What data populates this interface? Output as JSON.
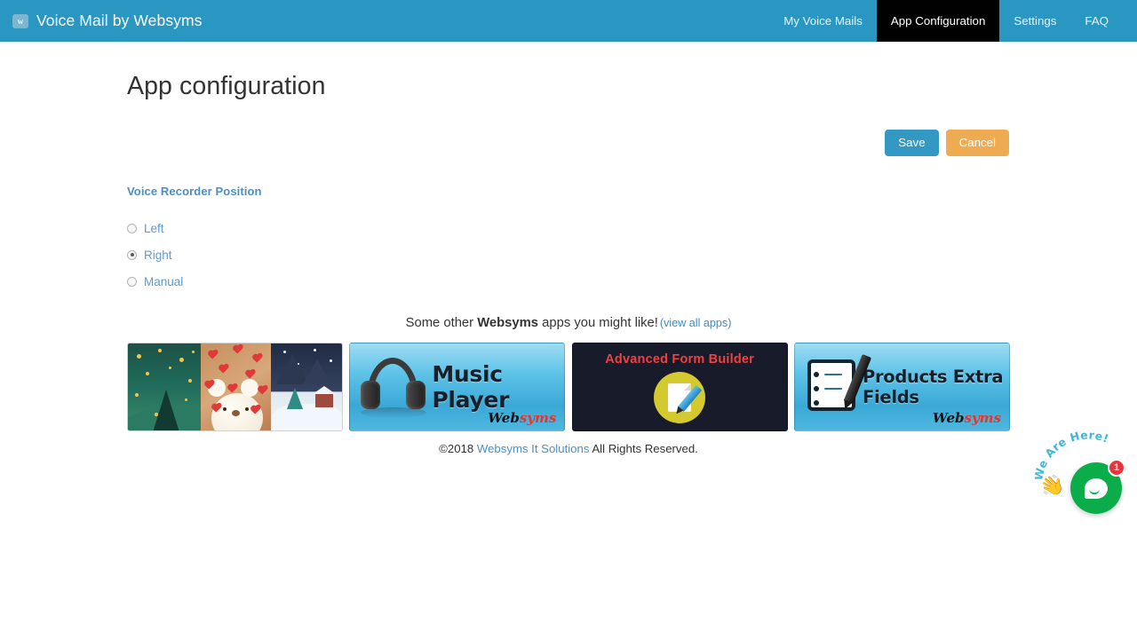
{
  "navbar": {
    "brand": "Voice Mail by Websyms",
    "brand_logo_glyph": "w",
    "items": [
      {
        "label": "My Voice Mails",
        "active": false
      },
      {
        "label": "App Configuration",
        "active": true
      },
      {
        "label": "Settings",
        "active": false
      },
      {
        "label": "FAQ",
        "active": false
      }
    ],
    "bg_color": "#2a96c2",
    "active_bg_color": "#010101"
  },
  "page": {
    "title": "App configuration"
  },
  "actions": {
    "save_label": "Save",
    "cancel_label": "Cancel",
    "save_color": "#3498c4",
    "cancel_color": "#eeab52"
  },
  "form": {
    "field_label": "Voice Recorder Position",
    "options": [
      {
        "label": "Left",
        "checked": false
      },
      {
        "label": "Right",
        "checked": true
      },
      {
        "label": "Manual",
        "checked": false
      }
    ],
    "label_color": "#4a90c4"
  },
  "promo": {
    "text_before": "Some other ",
    "brand": "Websyms",
    "text_after": " apps you might like!",
    "view_all_label": "(view all apps)",
    "banners": [
      {
        "name": "festive-images",
        "title": "",
        "logo": ""
      },
      {
        "name": "music-player",
        "title": "Music Player",
        "logo_web": "Web",
        "logo_syms": "syms"
      },
      {
        "name": "advanced-form-builder",
        "title": "Advanced Form Builder",
        "logo": ""
      },
      {
        "name": "products-extra-fields",
        "title": "Products Extra Fields",
        "logo_web": "Web",
        "logo_syms": "syms"
      }
    ]
  },
  "footer": {
    "copyright": "©2018",
    "company": "Websyms It Solutions",
    "rights": "All Rights Reserved."
  },
  "chat": {
    "caption": "We Are Here!",
    "badge_count": "1",
    "hand_glyph": "👋",
    "button_color": "#0bad4b",
    "badge_color": "#e8343c"
  }
}
